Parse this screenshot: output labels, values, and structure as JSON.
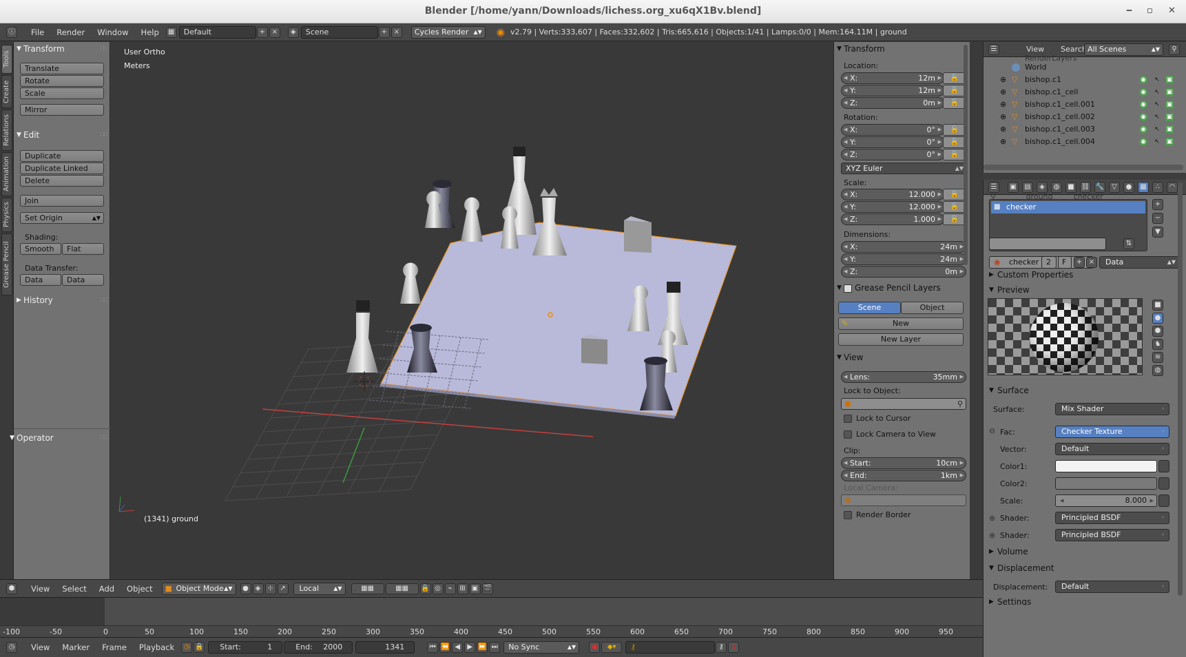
{
  "window": {
    "title": "Blender [/home/yann/Downloads/lichess.org_xu6qX1Bv.blend]",
    "minimize": "‒",
    "maximize": "▫",
    "close": "✕"
  },
  "info_header": {
    "menus": [
      "File",
      "Render",
      "Window",
      "Help"
    ],
    "screen_layout": "Default",
    "scene": "Scene",
    "render_engine": "Cycles Render",
    "stats": "v2.79 | Verts:333,607 | Faces:332,602 | Tris:665,616 | Objects:1/41 | Lamps:0/0 | Mem:164.11M | ground"
  },
  "tool_tabs": [
    "Tools",
    "Create",
    "Relations",
    "Animation",
    "Physics",
    "Grease Pencil"
  ],
  "toolshelf": {
    "transform_title": "Transform",
    "transform_buttons": [
      "Translate",
      "Rotate",
      "Scale"
    ],
    "mirror": "Mirror",
    "edit_title": "Edit",
    "edit_buttons": [
      "Duplicate",
      "Duplicate Linked",
      "Delete"
    ],
    "join": "Join",
    "set_origin": "Set Origin",
    "shading_label": "Shading:",
    "smooth": "Smooth",
    "flat": "Flat",
    "data_transfer_label": "Data Transfer:",
    "data": "Data",
    "data_layo": "Data Layo",
    "history_title": "History",
    "operator_title": "Operator"
  },
  "viewport": {
    "view_name": "User Ortho",
    "units": "Meters",
    "frame_object": "(1341) ground"
  },
  "npanel": {
    "transform_title": "Transform",
    "location_label": "Location:",
    "location": [
      {
        "k": "X:",
        "v": "12m"
      },
      {
        "k": "Y:",
        "v": "12m"
      },
      {
        "k": "Z:",
        "v": "0m"
      }
    ],
    "rotation_label": "Rotation:",
    "rotation": [
      {
        "k": "X:",
        "v": "0°"
      },
      {
        "k": "Y:",
        "v": "0°"
      },
      {
        "k": "Z:",
        "v": "0°"
      }
    ],
    "rotation_mode": "XYZ Euler",
    "scale_label": "Scale:",
    "scale": [
      {
        "k": "X:",
        "v": "12.000"
      },
      {
        "k": "Y:",
        "v": "12.000"
      },
      {
        "k": "Z:",
        "v": "1.000"
      }
    ],
    "dimensions_label": "Dimensions:",
    "dimensions": [
      {
        "k": "X:",
        "v": "24m"
      },
      {
        "k": "Y:",
        "v": "24m"
      },
      {
        "k": "Z:",
        "v": "0m"
      }
    ],
    "grease_title": "Grease Pencil Layers",
    "gp_scene": "Scene",
    "gp_object": "Object",
    "gp_new": "New",
    "gp_new_layer": "New Layer",
    "view_title": "View",
    "lens_label": "Lens:",
    "lens_value": "35mm",
    "lock_to_object": "Lock to Object:",
    "lock_to_cursor": "Lock to Cursor",
    "lock_camera": "Lock Camera to View",
    "clip_label": "Clip:",
    "clip_start_k": "Start:",
    "clip_start_v": "10cm",
    "clip_end_k": "End:",
    "clip_end_v": "1km",
    "local_camera": "Local Camera:",
    "render_border": "Render Border"
  },
  "outliner": {
    "view": "View",
    "search": "Search",
    "filter": "All Scenes",
    "rows": [
      {
        "name": "RenderLayers",
        "type": "layers"
      },
      {
        "name": "World",
        "type": "world"
      },
      {
        "name": "bishop.c1",
        "type": "mesh"
      },
      {
        "name": "bishop.c1_cell",
        "type": "mesh"
      },
      {
        "name": "bishop.c1_cell.001",
        "type": "mesh"
      },
      {
        "name": "bishop.c1_cell.002",
        "type": "mesh"
      },
      {
        "name": "bishop.c1_cell.003",
        "type": "mesh"
      },
      {
        "name": "bishop.c1_cell.004",
        "type": "mesh"
      }
    ]
  },
  "properties": {
    "breadcrumb_obj": "ground",
    "breadcrumb_tex": "checker",
    "slot_name": "checker",
    "datablock_name": "checker",
    "datablock_users": "2",
    "datablock_fake": "F",
    "data_dropdown": "Data",
    "custom_properties": "Custom Properties",
    "preview": "Preview",
    "surface_title": "Surface",
    "surface_label": "Surface:",
    "surface_value": "Mix Shader",
    "fac_label": "Fac:",
    "fac_value": "Checker Texture",
    "vector_label": "Vector:",
    "vector_value": "Default",
    "color1_label": "Color1:",
    "color2_label": "Color2:",
    "scale_label": "Scale:",
    "scale_value": "8.000",
    "shader1_label": "Shader:",
    "shader1_value": "Principled BSDF",
    "shader2_label": "Shader:",
    "shader2_value": "Principled BSDF",
    "volume": "Volume",
    "displacement_title": "Displacement",
    "displacement_label": "Displacement:",
    "displacement_value": "Default",
    "settings": "Settings"
  },
  "viewport_header": {
    "menus": [
      "View",
      "Select",
      "Add",
      "Object"
    ],
    "mode": "Object Mode",
    "orientation": "Local"
  },
  "timeline": {
    "ruler": [
      "-100",
      "-50",
      "0",
      "50",
      "100",
      "150",
      "200",
      "250",
      "300",
      "350",
      "400",
      "450",
      "500",
      "550",
      "600",
      "650",
      "700",
      "750",
      "800",
      "850",
      "900",
      "950"
    ],
    "menus": [
      "View",
      "Marker",
      "Frame",
      "Playback"
    ],
    "start_label": "Start:",
    "start_value": "1",
    "end_label": "End:",
    "end_value": "2000",
    "current": "1341",
    "sync": "No Sync"
  },
  "colors": {
    "accent_blue": "#5680c2",
    "selected_orange": "#f08c00",
    "board": "#b7b7d8",
    "x_axis": "#c44040",
    "y_axis": "#3c9a3c"
  }
}
